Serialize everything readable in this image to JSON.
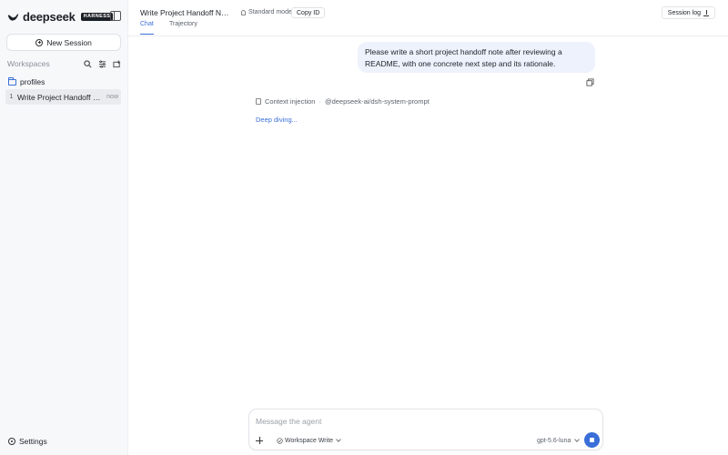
{
  "brand": {
    "name": "deepseek",
    "badge": "HARNESS"
  },
  "sidebar": {
    "new_session_label": "New Session",
    "workspaces_label": "Workspaces",
    "folder": "profiles",
    "sessions": [
      {
        "index": "1",
        "title": "Write Project Handoff Note with One Next Step",
        "time": "now"
      }
    ],
    "settings_label": "Settings"
  },
  "header": {
    "title": "Write Project Handoff Note with One Next Step",
    "mode": "Standard mode",
    "copy_id": "Copy ID",
    "session_log": "Session log",
    "tabs": [
      {
        "label": "Chat",
        "active": true
      },
      {
        "label": "Trajectory",
        "active": false
      }
    ]
  },
  "conversation": {
    "user_message": "Please write a short project handoff note after reviewing a README, with one concrete next step and its rationale.",
    "context_label": "Context injection",
    "context_source": "@deepseek-ai/dsh-system-prompt",
    "status": "Deep diving..."
  },
  "composer": {
    "placeholder": "Message the agent",
    "workspace_mode": "Workspace Write",
    "model": "gpt-5.6-luna"
  },
  "colors": {
    "accent": "#3a6fd8",
    "bubble": "#eef2fc",
    "sidebar": "#f7f8fa"
  }
}
